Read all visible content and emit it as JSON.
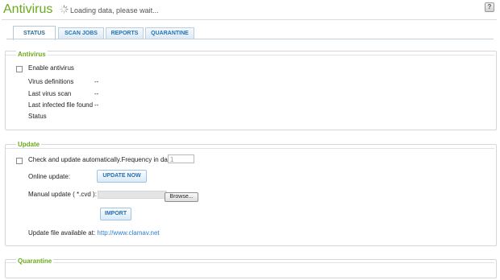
{
  "header": {
    "title": "Antivirus",
    "loading_text": "Loading data, please wait...",
    "help_label": "?"
  },
  "tabs": [
    {
      "label": "STATUS",
      "active": true
    },
    {
      "label": "SCAN JOBS",
      "active": false
    },
    {
      "label": "REPORTS",
      "active": false
    },
    {
      "label": "QUARANTINE",
      "active": false
    }
  ],
  "antivirus_section": {
    "legend": "Antivirus",
    "enable_label": "Enable antivirus",
    "enable_checked": false,
    "rows": [
      {
        "label": "Virus definitions",
        "value": "--"
      },
      {
        "label": "Last virus scan",
        "value": "--"
      },
      {
        "label": "Last infected file found",
        "value": "--"
      },
      {
        "label": "Status",
        "value": ""
      }
    ]
  },
  "update_section": {
    "legend": "Update",
    "auto_update_label": "Check and update automatically.Frequency in days:",
    "auto_update_checked": false,
    "frequency_value": "1",
    "online_update_label": "Online update:",
    "update_now_button": "UPDATE NOW",
    "manual_update_label": "Manual update ( *.cvd ):",
    "browse_button": "Browse...",
    "import_button": "IMPORT",
    "available_text": "Update file available at:",
    "available_link": "http://www.clamav.net"
  },
  "quarantine_section": {
    "legend": "Quarantine"
  },
  "colors": {
    "accent_green": "#6aaa1e",
    "tab_blue": "#1f72b8",
    "link_blue": "#2f7fcf"
  }
}
